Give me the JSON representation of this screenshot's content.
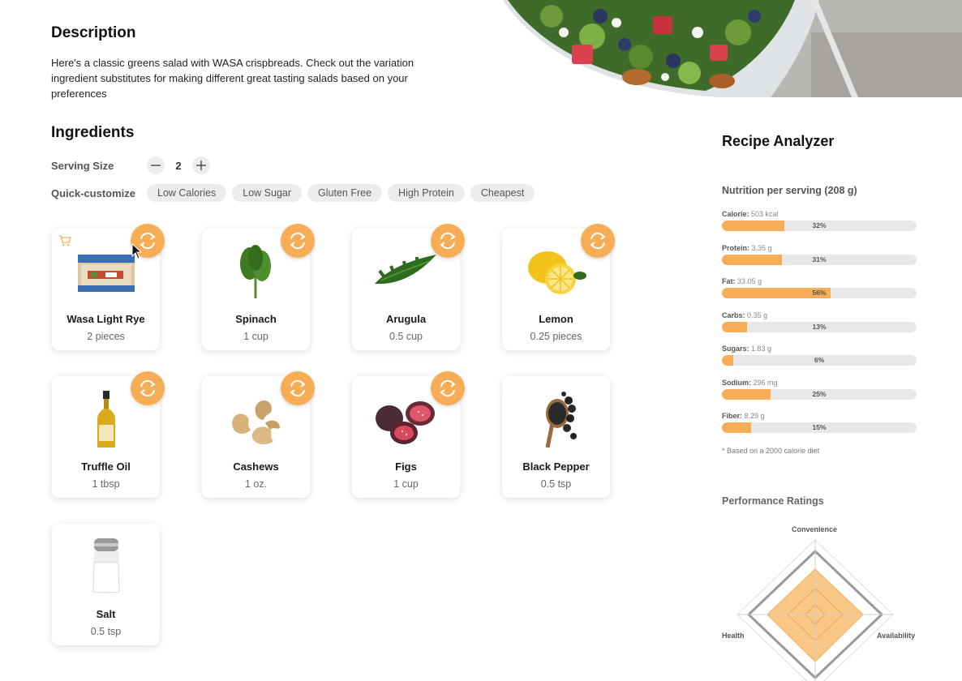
{
  "description": {
    "title": "Description",
    "text": "Here's a classic greens salad with WASA crispbreads. Check out the variation ingredient substitutes for making different great tasting salads based on your preferences"
  },
  "ingredients": {
    "title": "Ingredients",
    "serving_label": "Serving Size",
    "serving_value": "2",
    "quick_label": "Quick-customize",
    "chips": [
      "Low Calories",
      "Low Sugar",
      "Gluten Free",
      "High Protein",
      "Cheapest"
    ],
    "items": [
      {
        "name": "Wasa Light Rye",
        "qty": "2 pieces",
        "icon": "wasa-crispbread-icon",
        "swap": true,
        "cart": true
      },
      {
        "name": "Spinach",
        "qty": "1 cup",
        "icon": "spinach-icon",
        "swap": true
      },
      {
        "name": "Arugula",
        "qty": "0.5 cup",
        "icon": "arugula-icon",
        "swap": true
      },
      {
        "name": "Lemon",
        "qty": "0.25 pieces",
        "icon": "lemon-icon",
        "swap": true
      },
      {
        "name": "Truffle Oil",
        "qty": "1 tbsp",
        "icon": "oil-bottle-icon",
        "swap": true
      },
      {
        "name": "Cashews",
        "qty": "1 oz.",
        "icon": "cashews-icon",
        "swap": true
      },
      {
        "name": "Figs",
        "qty": "1 cup",
        "icon": "figs-icon",
        "swap": true
      },
      {
        "name": "Black Pepper",
        "qty": "0.5 tsp",
        "icon": "black-pepper-icon",
        "swap": false
      },
      {
        "name": "Salt",
        "qty": "0.5 tsp",
        "icon": "salt-shaker-icon",
        "swap": false
      }
    ]
  },
  "analyzer": {
    "title": "Recipe Analyzer",
    "nutrition_title": "Nutrition per serving (208 g)",
    "nutrients": [
      {
        "name": "Calorie:",
        "amount": "503 kcal",
        "pct_label": "32%",
        "pct": 32
      },
      {
        "name": "Protein:",
        "amount": "3.35 g",
        "pct_label": "31%",
        "pct": 31
      },
      {
        "name": "Fat:",
        "amount": "33.05 g",
        "pct_label": "56%",
        "pct": 56
      },
      {
        "name": "Carbs:",
        "amount": "0.35 g",
        "pct_label": "13%",
        "pct": 13
      },
      {
        "name": "Sugars:",
        "amount": "1.83 g",
        "pct_label": "6%",
        "pct": 6
      },
      {
        "name": "Sodium:",
        "amount": "296 mg",
        "pct_label": "25%",
        "pct": 25
      },
      {
        "name": "Fiber:",
        "amount": "8.29 g",
        "pct_label": "15%",
        "pct": 15
      }
    ],
    "footnote": "* Based on a 2000 calorie diet",
    "performance_title": "Performance Ratings",
    "radar_axes": [
      "Convenience",
      "Availability",
      "Health"
    ]
  },
  "colors": {
    "accent": "#f6ad55",
    "chip_bg": "#ececec",
    "bar_track": "#e8e8e8"
  }
}
